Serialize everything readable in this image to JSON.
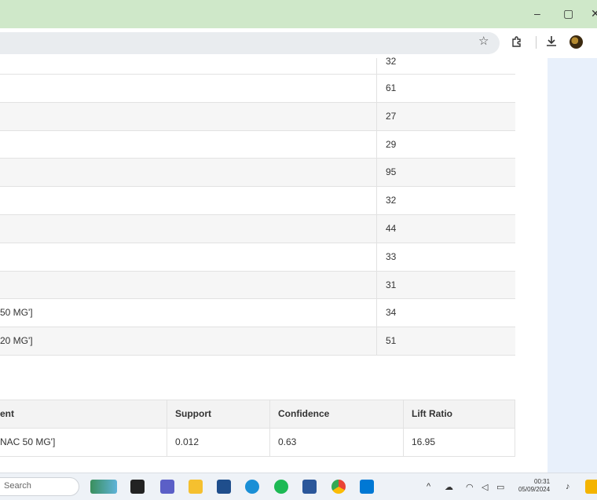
{
  "window": {
    "minimize_glyph": "–",
    "maximize_glyph": "▢",
    "close_glyph": "✕"
  },
  "toolbar": {
    "bookmark_icon": "star-icon",
    "extensions_icon": "puzzle-icon",
    "downloads_icon": "download-icon",
    "profile_icon": "avatar"
  },
  "table1": {
    "rows": [
      {
        "item": "",
        "count": "32"
      },
      {
        "item": "",
        "count": "61"
      },
      {
        "item": "",
        "count": "27"
      },
      {
        "item": "",
        "count": "29"
      },
      {
        "item": "",
        "count": "95"
      },
      {
        "item": "",
        "count": "32"
      },
      {
        "item": "",
        "count": "44"
      },
      {
        "item": "",
        "count": "33"
      },
      {
        "item": "",
        "count": "31"
      },
      {
        "item": "50 MG']",
        "count": "34"
      },
      {
        "item": "20 MG']",
        "count": "51"
      }
    ]
  },
  "table2": {
    "headers": [
      "ent",
      "Support",
      "Confidence",
      "Lift Ratio"
    ],
    "rows": [
      [
        "NAC 50 MG']",
        "0.012",
        "0.63",
        "16.95"
      ]
    ]
  },
  "taskbar": {
    "search_placeholder": "Search",
    "time": "00:31",
    "date": "05/09/2024",
    "colors": {
      "titlebar": "#cfe8c9",
      "side_panel": "#e8f0fb"
    }
  }
}
